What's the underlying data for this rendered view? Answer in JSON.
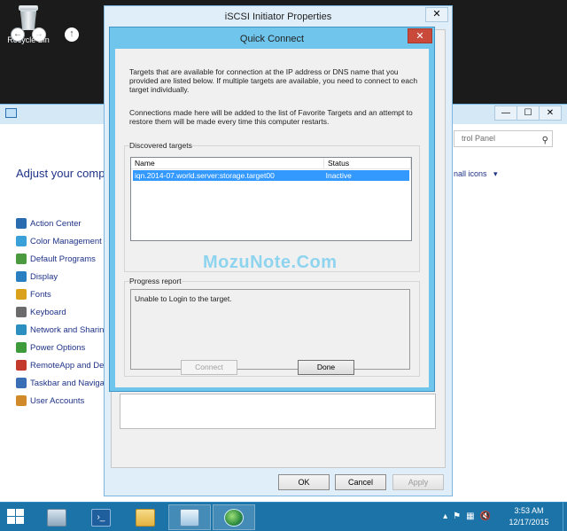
{
  "desktop": {
    "recycle_bin_label": "Recycle Bin"
  },
  "control_panel": {
    "search_placeholder": "trol Panel",
    "heading": "Adjust your compu",
    "view_by": "nall icons",
    "items": [
      {
        "label": "Action Center",
        "color": "#2b6cb0"
      },
      {
        "label": "Color Management",
        "color": "#3aa0d8"
      },
      {
        "label": "Default Programs",
        "color": "#4c9a3f"
      },
      {
        "label": "Display",
        "color": "#2a7fc0"
      },
      {
        "label": "Fonts",
        "color": "#d9a21a"
      },
      {
        "label": "Keyboard",
        "color": "#6b6b6b"
      },
      {
        "label": "Network and Sharin",
        "color": "#2c8fbf"
      },
      {
        "label": "Power Options",
        "color": "#3d9b3b"
      },
      {
        "label": "RemoteApp and Des",
        "color": "#c33a2c"
      },
      {
        "label": "Taskbar and Naviga",
        "color": "#3a6fb5"
      },
      {
        "label": "User Accounts",
        "color": "#d08a2a"
      }
    ],
    "window_controls": {
      "minimize": "—",
      "maximize": "☐",
      "close": "✕"
    }
  },
  "iscsi": {
    "title": "iSCSI Initiator Properties",
    "close": "✕",
    "ok_label": "OK",
    "cancel_label": "Cancel",
    "apply_label": "Apply"
  },
  "quick_connect": {
    "title": "Quick Connect",
    "close": "✕",
    "intro_text": "Targets that are available for connection at the IP address or DNS name that you provided are listed below.  If multiple targets are available, you need to connect to each target individually.",
    "favorites_text": "Connections made here will be added to the list of Favorite Targets and an attempt to restore them will be made every time this computer restarts.",
    "discovered_label": "Discovered targets",
    "columns": [
      "Name",
      "Status"
    ],
    "targets": [
      {
        "name": "iqn.2014-07.world.server:storage.target00",
        "status": "Inactive"
      }
    ],
    "progress_label": "Progress report",
    "progress_text": "Unable to Login to the target.",
    "connect_label": "Connect",
    "done_label": "Done"
  },
  "watermark": "MozuNote.Com",
  "taskbar": {
    "time": "3:53 AM",
    "date": "12/17/2015"
  }
}
